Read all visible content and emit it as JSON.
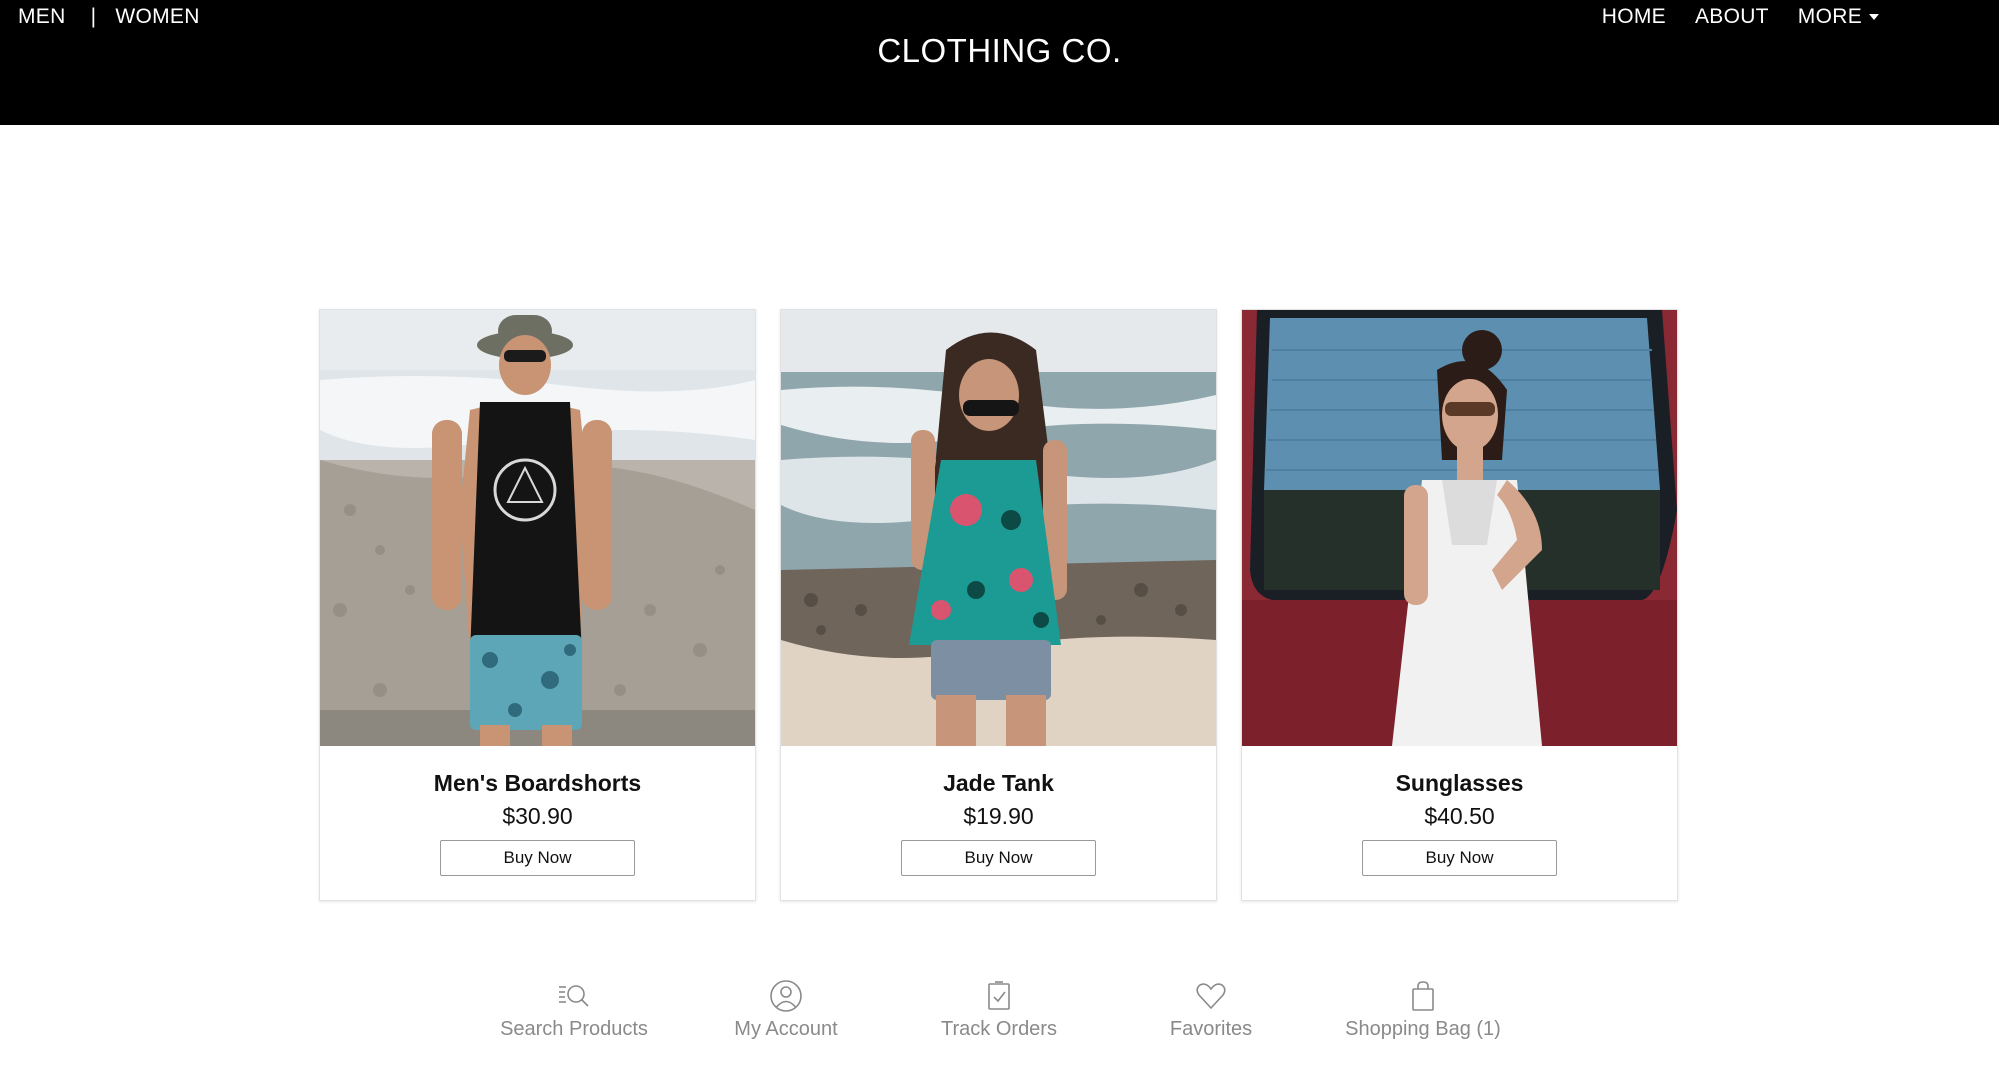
{
  "header": {
    "brand": "CLOTHING CO.",
    "left_nav": [
      "MEN",
      "WOMEN"
    ],
    "separator": "|",
    "right_nav": [
      "HOME",
      "ABOUT",
      "MORE"
    ]
  },
  "products": [
    {
      "name": "Men's Boardshorts",
      "price": "$30.90",
      "button": "Buy Now"
    },
    {
      "name": "Jade Tank",
      "price": "$19.90",
      "button": "Buy Now"
    },
    {
      "name": "Sunglasses",
      "price": "$40.50",
      "button": "Buy Now"
    }
  ],
  "bottom_nav": [
    {
      "label": "Search Products",
      "icon": "search-list-icon"
    },
    {
      "label": "My Account",
      "icon": "user-circle-icon"
    },
    {
      "label": "Track Orders",
      "icon": "checklist-icon"
    },
    {
      "label": "Favorites",
      "icon": "heart-icon"
    },
    {
      "label": "Shopping Bag (1)",
      "icon": "shopping-bag-icon"
    }
  ],
  "colors": {
    "header_bg": "#000000",
    "header_text": "#ffffff",
    "icon_gray": "#8a8a8a"
  }
}
